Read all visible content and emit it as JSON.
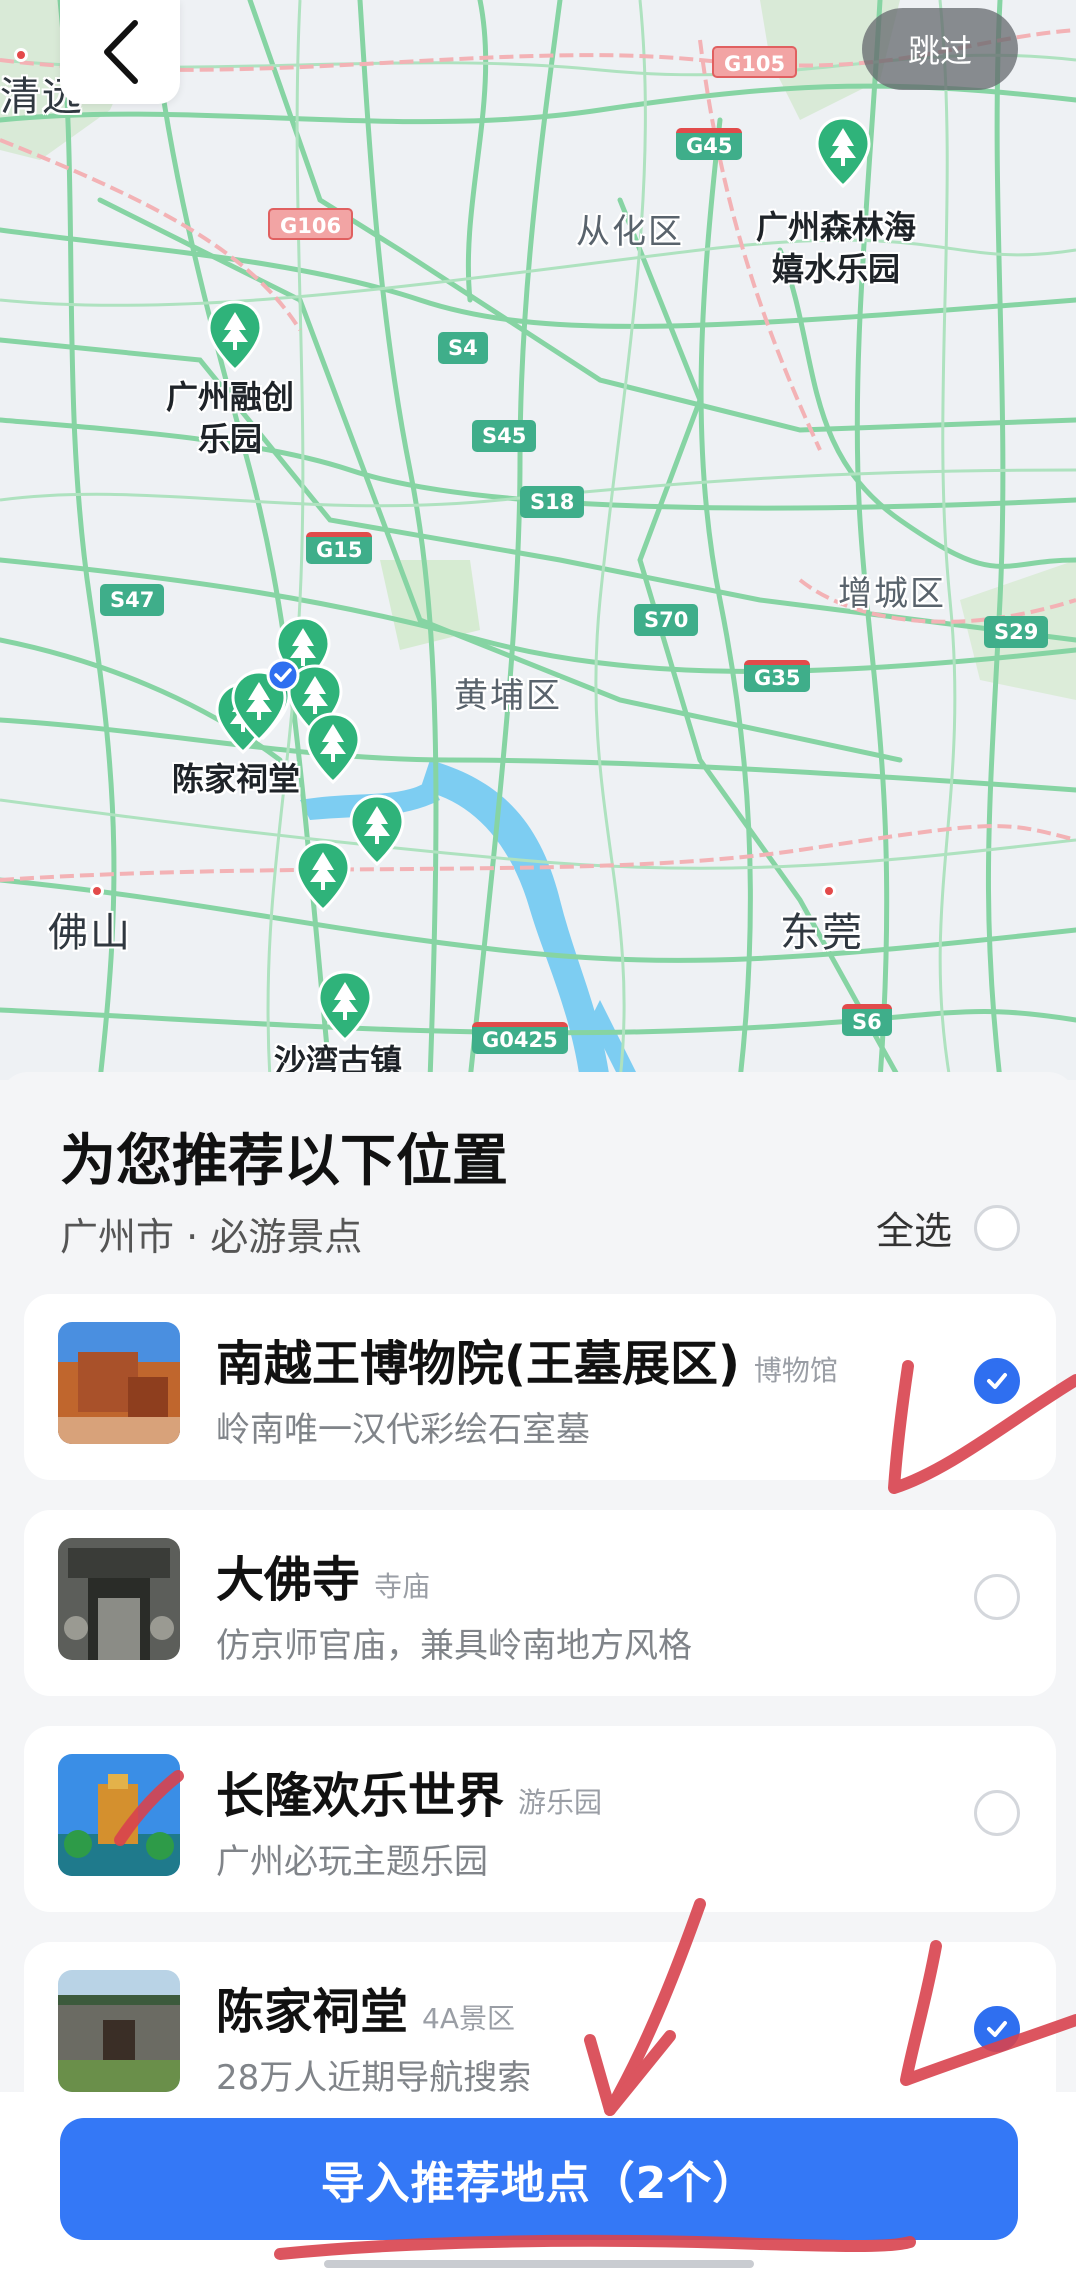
{
  "map": {
    "districts": [
      "从化区",
      "增城区",
      "黄埔区"
    ],
    "cities": [
      "清远",
      "佛山",
      "东莞"
    ],
    "pois": [
      {
        "label": "广州森林海\n嬉水乐园"
      },
      {
        "label": "广州融创\n乐园"
      },
      {
        "label": "陈家祠堂"
      },
      {
        "label": "沙湾古镇"
      }
    ],
    "roads": [
      "G105",
      "G45",
      "G106",
      "S4",
      "S45",
      "S18",
      "G15",
      "S47",
      "S70",
      "G35",
      "S29",
      "G0425",
      "S6"
    ]
  },
  "header": {
    "back_icon": "chevron-left-icon",
    "skip_label": "跳过"
  },
  "panel": {
    "title": "为您推荐以下位置",
    "subtitle": "广州市 · 必游景点",
    "select_all_label": "全选",
    "select_all_checked": false
  },
  "places": [
    {
      "name": "南越王博物院(王墓展区)",
      "tag": "博物馆",
      "desc": "岭南唯一汉代彩绘石室墓",
      "checked": true
    },
    {
      "name": "大佛寺",
      "tag": "寺庙",
      "desc": "仿京师官庙，兼具岭南地方风格",
      "checked": false
    },
    {
      "name": "长隆欢乐世界",
      "tag": "游乐园",
      "desc": "广州必玩主题乐园",
      "checked": false
    },
    {
      "name": "陈家祠堂",
      "tag": "4A景区",
      "desc": "28万人近期导航搜索",
      "checked": true
    }
  ],
  "footer": {
    "import_label": "导入推荐地点（2个）"
  },
  "colors": {
    "accent": "#3478f6",
    "checkbox_on": "#2f6ff0",
    "pin_green": "#2fb37a",
    "annotation_red": "#d8434e"
  }
}
